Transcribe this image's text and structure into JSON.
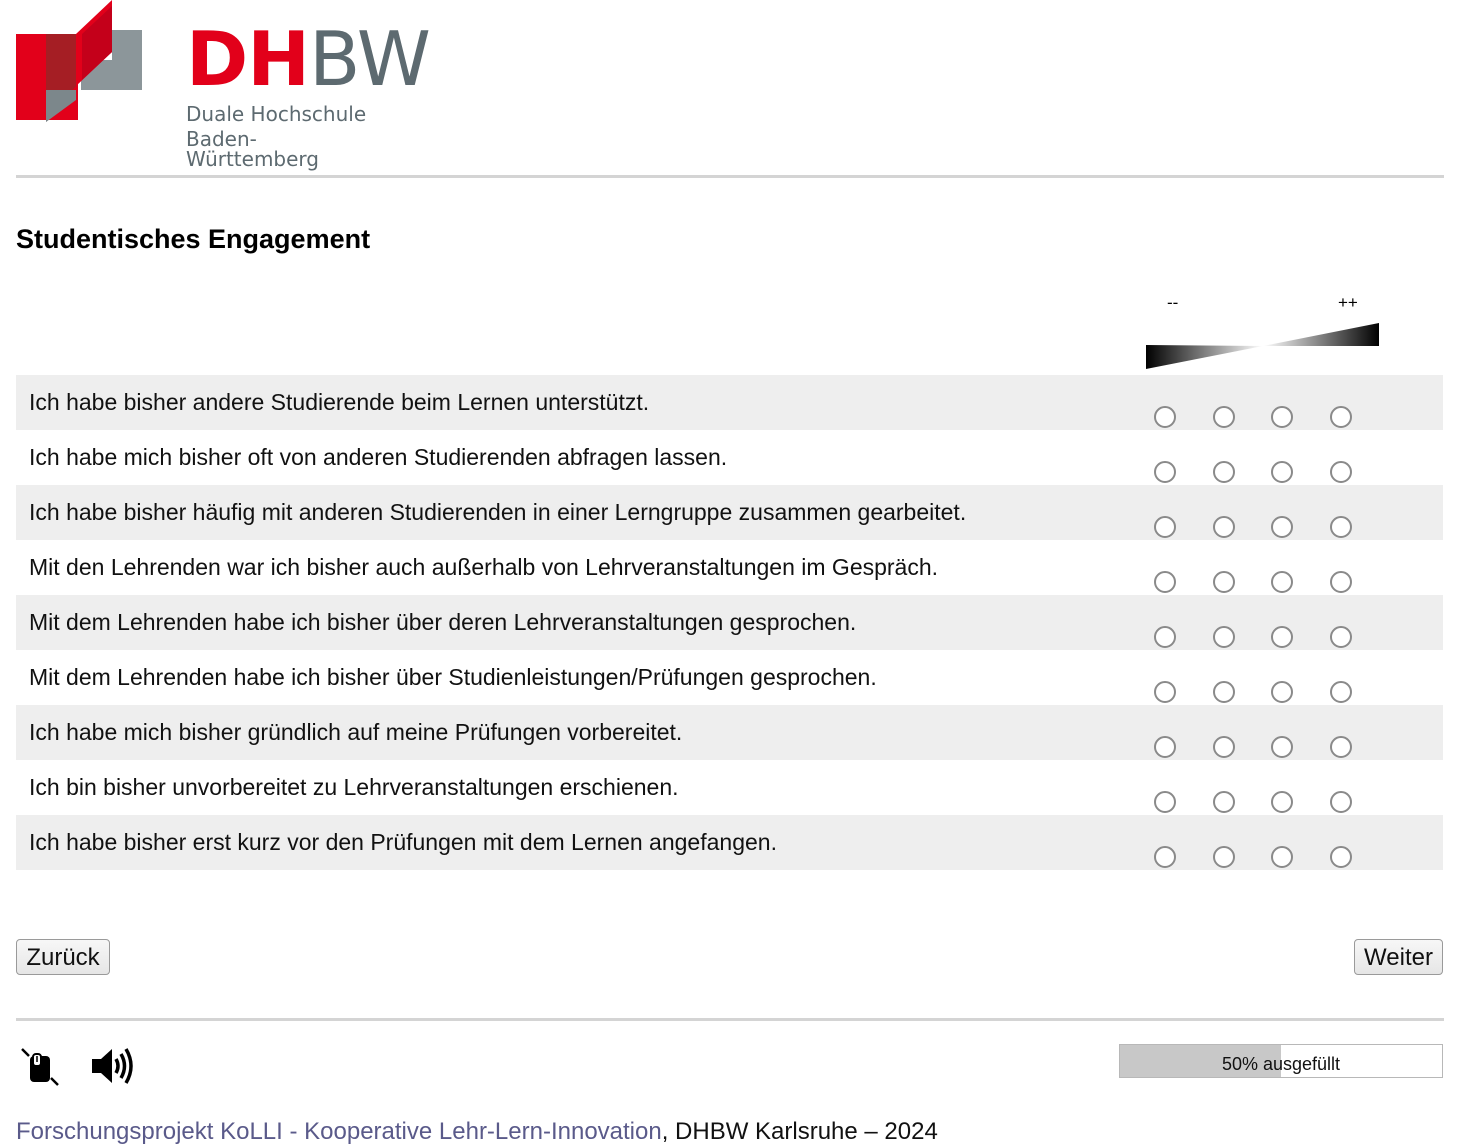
{
  "logo": {
    "wordmark_dh": "DH",
    "wordmark_bw": "BW",
    "line1": "Duale Hochschule",
    "line2": "Baden-Württemberg",
    "colors": {
      "red": "#e2001a",
      "gray": "#5d6a70"
    }
  },
  "section": {
    "title": "Studentisches Engagement"
  },
  "scale": {
    "low_label": "--",
    "high_label": "++",
    "options_count": 4
  },
  "questions": [
    "Ich habe bisher andere Studierende beim Lernen unterstützt.",
    "Ich habe mich bisher oft von anderen Studierenden abfragen lassen.",
    "Ich habe bisher häufig mit anderen Studierenden in einer Lerngruppe zusammen gearbeitet.",
    "Mit den Lehrenden war ich bisher auch außerhalb von Lehrveranstaltungen im Gespräch.",
    "Mit dem Lehrenden habe ich bisher über deren Lehrveranstaltungen gesprochen.",
    "Mit dem Lehrenden habe ich bisher über Studienleistungen/Prüfungen gesprochen.",
    "Ich habe mich bisher gründlich auf meine Prüfungen vorbereitet.",
    "Ich bin bisher unvorbereitet zu Lehrveranstaltungen erschienen.",
    "Ich habe bisher erst kurz vor den Prüfungen mit dem Lernen angefangen."
  ],
  "nav": {
    "back_label": "Zurück",
    "next_label": "Weiter"
  },
  "toolbar": {
    "icons": [
      "mouse-zoom-icon",
      "speaker-icon"
    ]
  },
  "progress": {
    "label": "50% ausgefüllt",
    "fraction": 0.5
  },
  "footer": {
    "link_text": "Forschungsprojekt KoLLI - Kooperative Lehr-Lern-Innovation",
    "suffix": ", DHBW Karlsruhe – 2024",
    "link_color": "#5a5a8a"
  }
}
